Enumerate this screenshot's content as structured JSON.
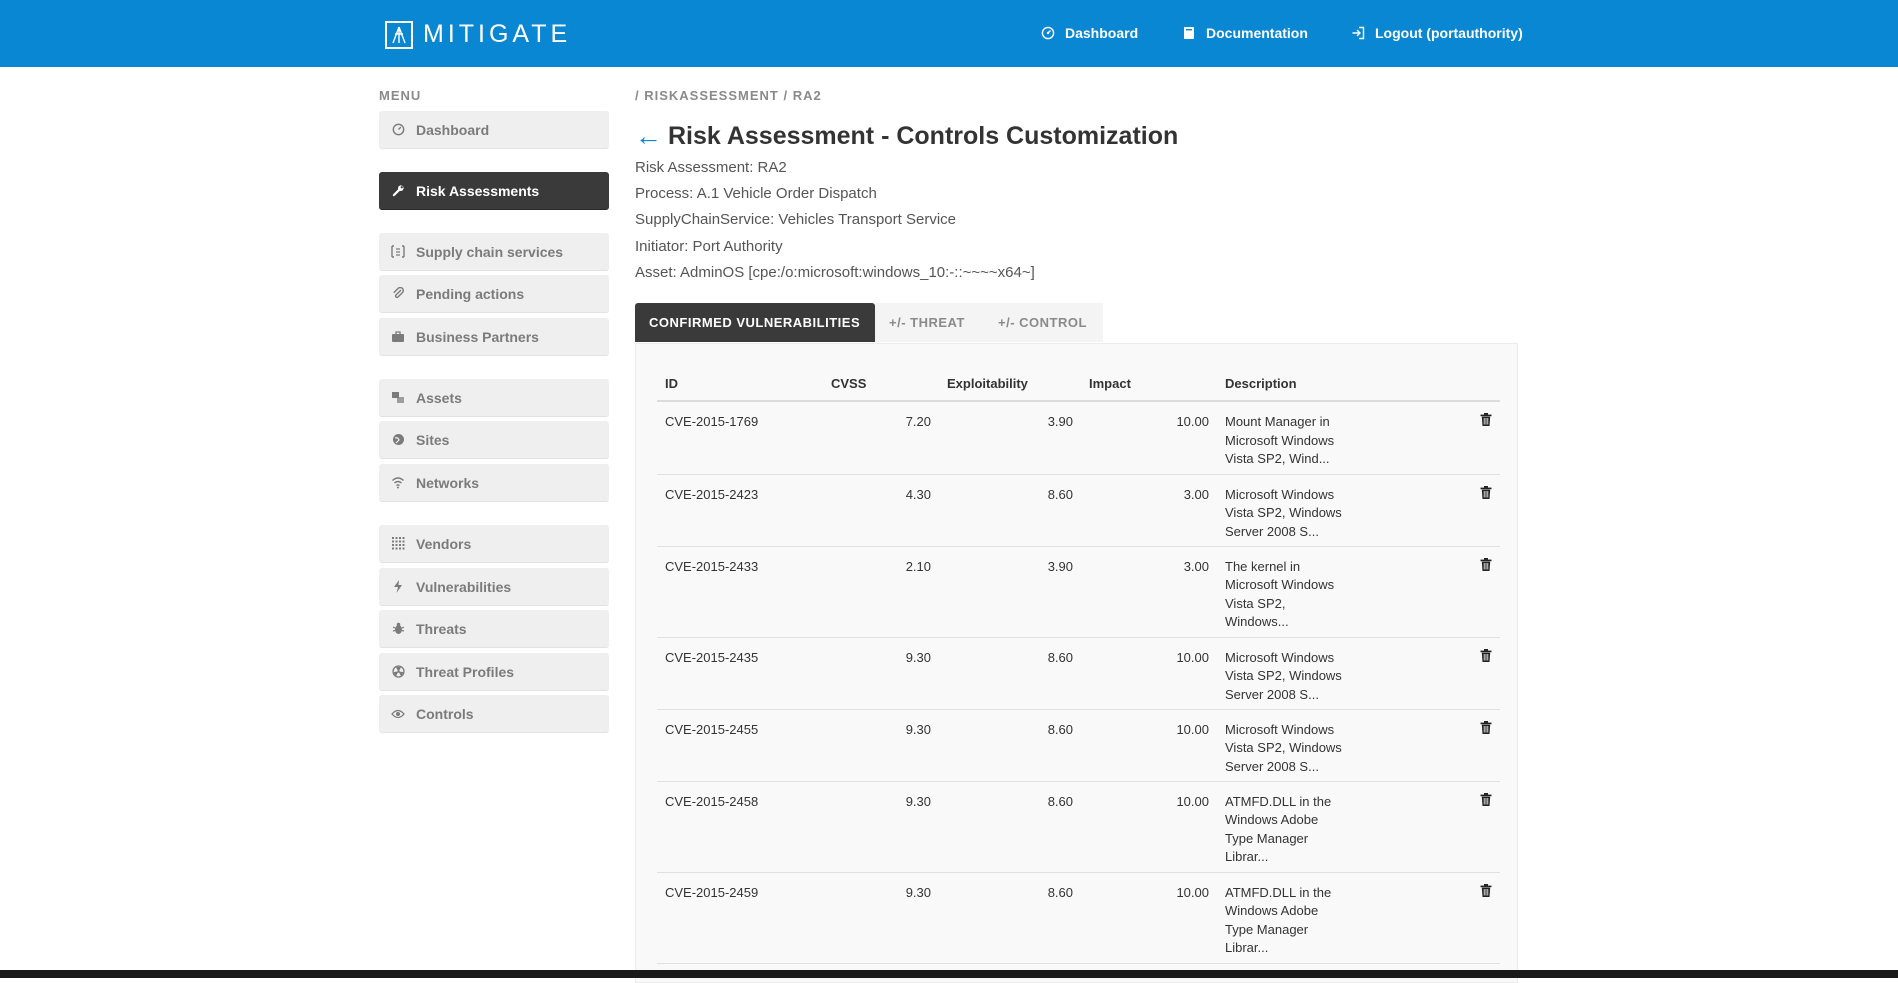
{
  "app": {
    "brand": "MITIGATE",
    "nav": {
      "dashboard": "Dashboard",
      "documentation": "Documentation",
      "logout": "Logout (portauthority)"
    }
  },
  "sidebar": {
    "title": "MENU",
    "items": [
      {
        "label": "Dashboard",
        "icon": "dashboard-icon"
      },
      {
        "label": "Risk Assessments",
        "icon": "wrench-icon",
        "active": true
      },
      {
        "label": "Supply chain services",
        "icon": "supply-chain-icon"
      },
      {
        "label": "Pending actions",
        "icon": "paperclip-icon"
      },
      {
        "label": "Business Partners",
        "icon": "briefcase-icon"
      },
      {
        "label": "Assets",
        "icon": "assets-icon"
      },
      {
        "label": "Sites",
        "icon": "globe-icon"
      },
      {
        "label": "Networks",
        "icon": "wifi-icon"
      },
      {
        "label": "Vendors",
        "icon": "grid-icon"
      },
      {
        "label": "Vulnerabilities",
        "icon": "bolt-icon"
      },
      {
        "label": "Threats",
        "icon": "bug-icon"
      },
      {
        "label": "Threat Profiles",
        "icon": "radiation-icon"
      },
      {
        "label": "Controls",
        "icon": "eye-icon"
      }
    ]
  },
  "breadcrumb": "/ RISKASSESSMENT / RA2",
  "page": {
    "back": "←",
    "title": "Risk Assessment - Controls Customization",
    "meta": [
      "Risk Assessment: RA2",
      "Process: A.1 Vehicle Order Dispatch",
      "SupplyChainService: Vehicles Transport Service",
      "Initiator: Port Authority",
      "Asset: AdminOS [cpe:/o:microsoft:windows_10:-::~~~~x64~]"
    ]
  },
  "tabs": [
    {
      "label": "CONFIRMED VULNERABILITIES",
      "active": true
    },
    {
      "label": "+/- THREAT"
    },
    {
      "label": "+/- CONTROL"
    }
  ],
  "table": {
    "headers": [
      "ID",
      "CVSS",
      "Exploitability",
      "Impact",
      "Description"
    ],
    "rows": [
      {
        "id": "CVE-2015-1769",
        "cvss": "7.20",
        "expl": "3.90",
        "impact": "10.00",
        "desc": [
          "Mount Manager in",
          "Microsoft Windows",
          "Vista SP2, Wind..."
        ]
      },
      {
        "id": "CVE-2015-2423",
        "cvss": "4.30",
        "expl": "8.60",
        "impact": "3.00",
        "desc": [
          "Microsoft Windows",
          "Vista SP2, Windows",
          "Server 2008 S..."
        ]
      },
      {
        "id": "CVE-2015-2433",
        "cvss": "2.10",
        "expl": "3.90",
        "impact": "3.00",
        "desc": [
          "The kernel in",
          "Microsoft Windows",
          "Vista SP2,",
          "Windows..."
        ]
      },
      {
        "id": "CVE-2015-2435",
        "cvss": "9.30",
        "expl": "8.60",
        "impact": "10.00",
        "desc": [
          "Microsoft Windows",
          "Vista SP2, Windows",
          "Server 2008 S..."
        ]
      },
      {
        "id": "CVE-2015-2455",
        "cvss": "9.30",
        "expl": "8.60",
        "impact": "10.00",
        "desc": [
          "Microsoft Windows",
          "Vista SP2, Windows",
          "Server 2008 S..."
        ]
      },
      {
        "id": "CVE-2015-2458",
        "cvss": "9.30",
        "expl": "8.60",
        "impact": "10.00",
        "desc": [
          "ATMFD.DLL in the",
          "Windows Adobe",
          "Type Manager",
          "Librar..."
        ]
      },
      {
        "id": "CVE-2015-2459",
        "cvss": "9.30",
        "expl": "8.60",
        "impact": "10.00",
        "desc": [
          "ATMFD.DLL in the",
          "Windows Adobe",
          "Type Manager",
          "Librar..."
        ]
      }
    ]
  },
  "colors": {
    "topbar": "#0a87d3",
    "active": "#3a3a3a",
    "sidebar_bg": "#efefef",
    "panel_bg": "#f9f9f9"
  }
}
